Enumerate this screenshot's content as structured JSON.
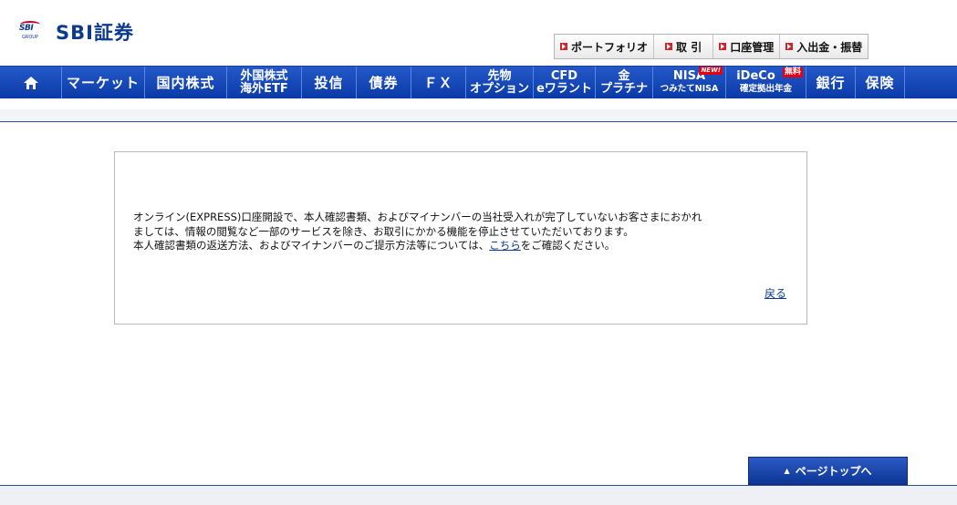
{
  "brand": {
    "mark": "SBI",
    "group": "GROUP",
    "name": "SBI証券"
  },
  "utility_nav": [
    {
      "label": "ポートフォリオ",
      "icon": "arrow-square-icon"
    },
    {
      "label": "取 引",
      "icon": "arrow-square-icon"
    },
    {
      "label": "口座管理",
      "icon": "arrow-square-icon"
    },
    {
      "label": "入出金・振替",
      "icon": "arrow-square-icon"
    }
  ],
  "global_nav": {
    "home_icon": "home-icon",
    "market": "マーケット",
    "domestic_stock": "国内株式",
    "foreign_line1": "外国株式",
    "foreign_line2": "海外ETF",
    "funds": "投信",
    "bonds": "債券",
    "fx": "ＦＸ",
    "futures_line1": "先物",
    "futures_line2": "オプション",
    "cfd_line1": "CFD",
    "cfd_line2": "eワラント",
    "gold_line1": "金",
    "gold_line2": "プラチナ",
    "nisa_line1": "NISA",
    "nisa_line2": "つみたてNISA",
    "nisa_badge": "NEW!",
    "ideco_line1": "iDeCo",
    "ideco_line2": "確定拠出年金",
    "ideco_badge": "無料",
    "bank": "銀行",
    "insurance": "保険"
  },
  "message": {
    "line1": "オンライン(EXPRESS)口座開設で、本人確認書類、およびマイナンバーの当社受入れが完了していないお客さまにおかれ",
    "line2": "ましては、情報の閲覧など一部のサービスを除き、お取引にかかる機能を停止させていただいております。",
    "line3_before": "本人確認書類の返送方法、およびマイナンバーのご提示方法等については、",
    "link": "こちら",
    "line3_after": "をご確認ください。",
    "back": "戻る"
  },
  "footer": {
    "pagetop": "ページトップへ",
    "pagetop_icon": "chevron-up-icon"
  },
  "colors": {
    "brand_blue": "#0b3a8f",
    "nav_blue": "#1b4bb9",
    "accent_red": "#d2232a"
  }
}
